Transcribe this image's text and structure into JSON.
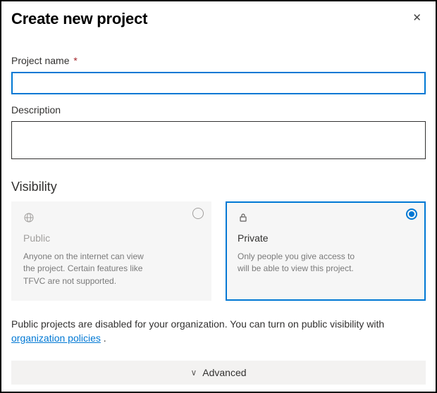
{
  "dialog": {
    "title": "Create new project"
  },
  "fields": {
    "project_name_label": "Project name",
    "project_name_value": "",
    "description_label": "Description",
    "description_value": ""
  },
  "visibility": {
    "heading": "Visibility",
    "public": {
      "title": "Public",
      "desc": "Anyone on the internet can view the project. Certain features like TFVC are not supported."
    },
    "private": {
      "title": "Private",
      "desc": "Only people you give access to will be able to view this project."
    }
  },
  "note": {
    "prefix": "Public projects are disabled for your organization. You can turn on public visibility with ",
    "link": "organization policies",
    "suffix": " ."
  },
  "advanced_label": "Advanced"
}
